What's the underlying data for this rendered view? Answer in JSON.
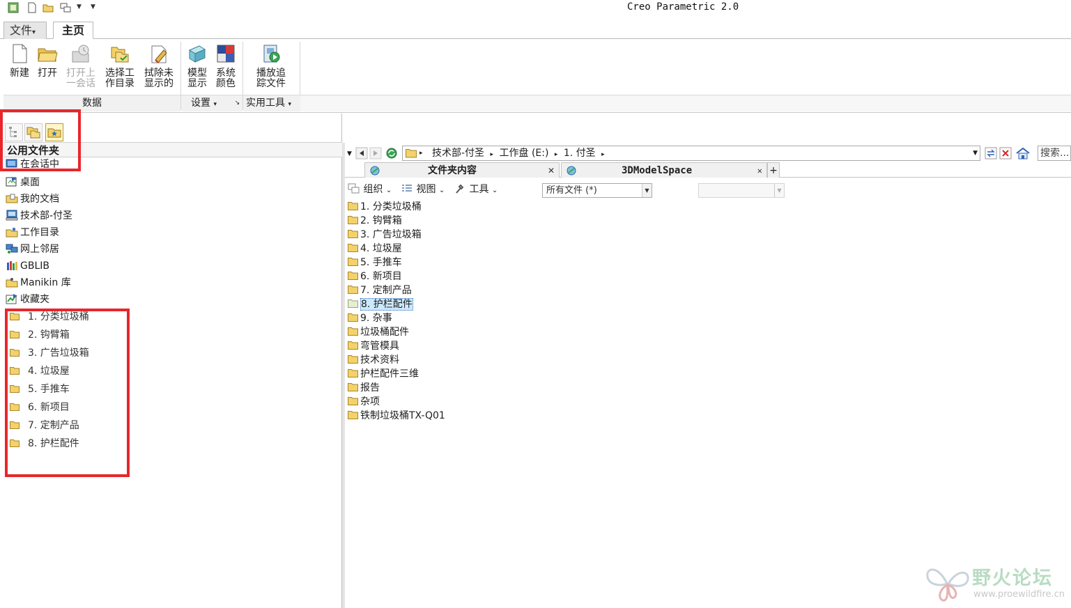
{
  "window": {
    "title": "Creo Parametric 2.0"
  },
  "ribbon": {
    "tabs": [
      {
        "label": "文件",
        "arrow": "▾"
      },
      {
        "label": "主页"
      }
    ],
    "buttons": [
      {
        "line1": "新建",
        "line2": ""
      },
      {
        "line1": "打开",
        "line2": ""
      },
      {
        "line1": "打开上",
        "line2": "一会话"
      },
      {
        "line1": "选择工",
        "line2": "作目录"
      },
      {
        "line1": "拭除未",
        "line2": "显示的"
      },
      {
        "line1": "模型",
        "line2": "显示"
      },
      {
        "line1": "系统",
        "line2": "颜色"
      },
      {
        "line1": "播放追",
        "line2": "踪文件"
      }
    ],
    "groups": [
      {
        "label": "数据"
      },
      {
        "label": "设置",
        "arrow": "▾"
      },
      {
        "label": "实用工具",
        "arrow": "▾"
      }
    ]
  },
  "navigator": {
    "header": "公用文件夹",
    "items": [
      {
        "label": "在会话中",
        "icon": "session-icon"
      },
      {
        "label": "桌面",
        "icon": "desktop-icon"
      },
      {
        "label": "我的文档",
        "icon": "my-documents-icon"
      },
      {
        "label": "技术部-付圣",
        "icon": "computer-icon"
      },
      {
        "label": "工作目录",
        "icon": "working-directory-icon"
      },
      {
        "label": "网上邻居",
        "icon": "network-icon"
      },
      {
        "label": "GBLIB",
        "icon": "library-icon"
      },
      {
        "label": "Manikin 库",
        "icon": "manikin-library-icon"
      },
      {
        "label": "收藏夹",
        "icon": "favorites-icon"
      }
    ],
    "favorites": [
      "1. 分类垃圾桶",
      "2. 钩臂箱",
      "3. 广告垃圾箱",
      "4. 垃圾屋",
      "5. 手推车",
      "6. 新项目",
      "7. 定制产品",
      "8. 护栏配件"
    ]
  },
  "browser": {
    "breadcrumb": [
      {
        "label": "技术部-付圣"
      },
      {
        "label": "工作盘 (E:)"
      },
      {
        "label": "1. 付圣"
      }
    ],
    "search_placeholder": "搜索...",
    "tabs": [
      {
        "label": "文件夹内容"
      },
      {
        "label": "3DModelSpace"
      }
    ],
    "toolbar": {
      "organize": "组织",
      "view": "视图",
      "tools": "工具"
    },
    "filter_value": "所有文件 (*)",
    "files": [
      {
        "label": "1. 分类垃圾桶",
        "selected": false
      },
      {
        "label": "2. 钩臂箱",
        "selected": false
      },
      {
        "label": "3. 广告垃圾箱",
        "selected": false
      },
      {
        "label": "4. 垃圾屋",
        "selected": false
      },
      {
        "label": "5. 手推车",
        "selected": false
      },
      {
        "label": "6. 新项目",
        "selected": false
      },
      {
        "label": "7. 定制产品",
        "selected": false
      },
      {
        "label": "8. 护栏配件",
        "selected": true
      },
      {
        "label": "9. 杂事",
        "selected": false
      },
      {
        "label": "垃圾桶配件",
        "selected": false
      },
      {
        "label": "弯管模具",
        "selected": false
      },
      {
        "label": "技术资料",
        "selected": false
      },
      {
        "label": "护栏配件三维",
        "selected": false
      },
      {
        "label": "报告",
        "selected": false
      },
      {
        "label": "杂项",
        "selected": false
      },
      {
        "label": "铁制垃圾桶TX-Q01",
        "selected": false
      }
    ]
  },
  "watermark": {
    "title": "野火论坛",
    "url": "www.proewildfire.cn"
  },
  "colors": {
    "annotation_red": "#e8262b",
    "folder_yellow": "#f3d26b",
    "selection_blue": "#cce8ff"
  }
}
